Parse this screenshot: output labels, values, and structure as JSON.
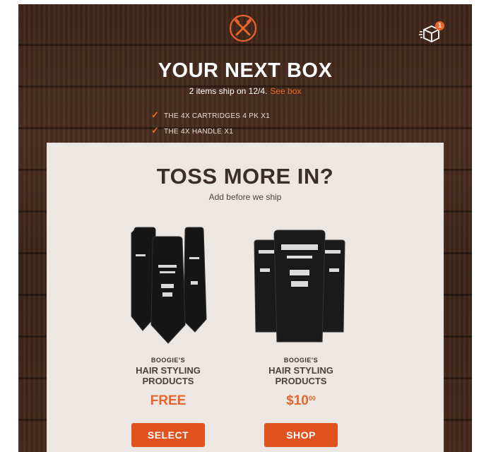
{
  "header": {
    "logo_icon": "crossed-razors-icon",
    "cart_icon": "box-cart-icon",
    "cart_count": "1",
    "title": "YOUR NEXT BOX",
    "ship_text": "2 items ship on 12/4.",
    "see_box_link": "See box"
  },
  "box_items": [
    {
      "label": "THE 4X CARTRIDGES 4 PK X1"
    },
    {
      "label": "THE 4X HANDLE X1"
    }
  ],
  "upsell": {
    "title": "TOSS MORE IN?",
    "subtitle": "Add before we ship",
    "products": [
      {
        "brand": "BOOGIE'S",
        "name": "HAIR STYLING PRODUCTS",
        "price": "FREE",
        "button": "SELECT",
        "packaging": "packets"
      },
      {
        "brand": "BOOGIE'S",
        "name": "HAIR STYLING PRODUCTS",
        "price": "$10",
        "price_cents": "00",
        "button": "SHOP",
        "packaging": "tubes"
      }
    ]
  },
  "colors": {
    "accent": "#e8642a",
    "button": "#e0521f",
    "wood": "#3d2519",
    "panel": "#ece7e3"
  }
}
